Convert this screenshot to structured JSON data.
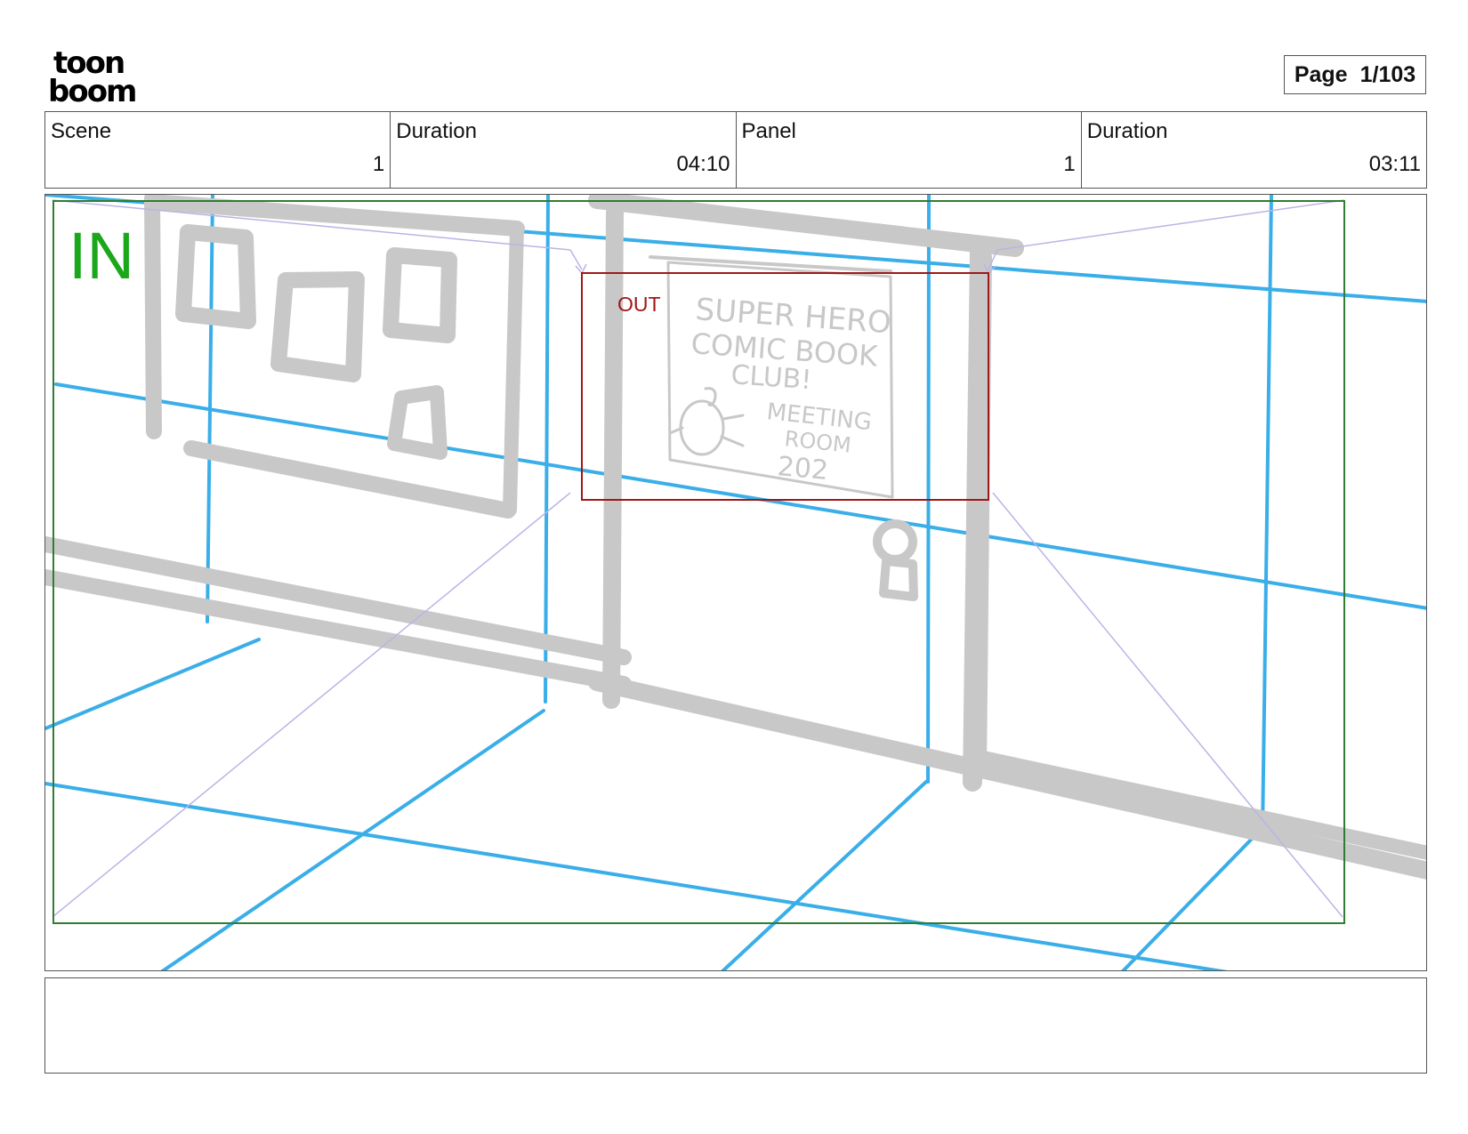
{
  "header": {
    "logo_text_top": "toon",
    "logo_text_bottom": "boom",
    "page_label": "Page",
    "page_value": "1/103"
  },
  "info": {
    "scene_label": "Scene",
    "scene_value": "1",
    "scene_duration_label": "Duration",
    "scene_duration_value": "04:10",
    "panel_label": "Panel",
    "panel_value": "1",
    "panel_duration_label": "Duration",
    "panel_duration_value": "03:11"
  },
  "panel": {
    "in_label": "IN",
    "out_label": "OUT",
    "poster_lines": [
      "SUPER HERO",
      "COMIC BOOK",
      "CLUB!",
      "MEETING",
      "ROOM",
      "202"
    ],
    "colors": {
      "in_frame": "#2e7d32",
      "in_text": "#1aa81a",
      "out_frame": "#a01717",
      "grid": "#3aaee8",
      "sketch": "#c8c8c8",
      "camera_path": "#b9b4e6"
    }
  },
  "notes": {
    "text": ""
  }
}
